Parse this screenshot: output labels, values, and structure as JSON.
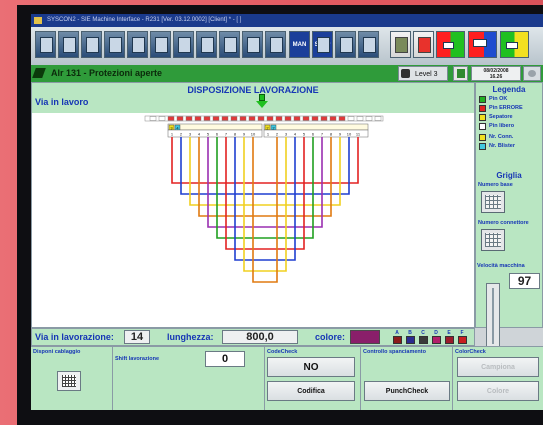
{
  "window": {
    "title": "SYSCON2 - SIE Machine Interface - R231 [Ver. 03.12.0002] [Client] * - [ ]"
  },
  "status": {
    "message": "Alr 131 - Protezioni aperte",
    "level": "Level 3",
    "date": "08/02/2008",
    "time": "16.26"
  },
  "toolbar": {
    "man_label": "MAN",
    "step_label": "STEP",
    "icons": [
      "machine-icon",
      "harness-icon",
      "graph-icon",
      "list-icon",
      "table-icon",
      "layout-icon",
      "monitor-icon",
      "tools-icon",
      "book-icon",
      "calendar-icon",
      "chart-icon",
      "step-icon",
      "grid-icon",
      "layers-icon",
      "terminal-icon",
      "cutter-icon",
      "connector-red-green-icon",
      "connector-red-blue-icon",
      "connector-green-yellow-icon"
    ]
  },
  "main": {
    "title": "DISPOSIZIONE LAVORAZIONE",
    "via_label": "Via in lavoro"
  },
  "legend": {
    "title": "Legenda",
    "items": [
      {
        "label": "Pin OK",
        "color": "#22b022"
      },
      {
        "label": "Pin ERRORE",
        "color": "#e32222"
      },
      {
        "label": "Sepatore",
        "color": "#f0e020"
      },
      {
        "label": "Pin libero",
        "color": "#ffffff"
      },
      {
        "label": "Nr. Conn.",
        "color": "#f0e020"
      },
      {
        "label": "Nr. Blister",
        "color": "#40c8e0"
      }
    ],
    "griglia_title": "Griglia",
    "numero_base": "Numero base",
    "numero_connettore": "Numero connettore",
    "speed_label": "Velocità macchina",
    "speed_value": "97"
  },
  "info": {
    "via_label": "Via in lavorazione:",
    "via_value": "14",
    "lunghezza_label": "lunghezza:",
    "lunghezza_value": "800,0",
    "colore_label": "colore:",
    "palette_letters": [
      "A",
      "B",
      "C",
      "D",
      "E",
      "F"
    ],
    "palette_colors": [
      "#8b1a1a",
      "#2b2b8f",
      "#3a3a3a",
      "#b21f6a",
      "#9a1b2a",
      "#c82020"
    ]
  },
  "bottom": {
    "disponi_label": "Disponi cablaggio",
    "shift_label": "Shift lavorazione",
    "shift_value": "0",
    "codecheck_label": "CodeCheck",
    "no_label": "NO",
    "codifica_label": "Codifica",
    "controllo_label": "Controllo spanciamento",
    "punchcheck_label": "PunchCheck",
    "colorcheck_label": "ColorCheck",
    "campiona_label": "Campiona",
    "colore_label": "Colore"
  },
  "chart_data": {
    "type": "diagram",
    "left_connector_pins": [
      "1",
      "2",
      "3",
      "4",
      "5",
      "6",
      "7",
      "8",
      "9",
      "10"
    ],
    "right_connector_pins": [
      "1",
      "2",
      "3",
      "4",
      "5",
      "6",
      "7",
      "8",
      "9",
      "10",
      "11"
    ],
    "connector_labels": [
      "3",
      "4",
      "2",
      "2"
    ],
    "wire_colors": [
      "#e32222",
      "#1f3fd0",
      "#f0d020",
      "#e07a10",
      "#9a2fb0",
      "#20a020"
    ]
  }
}
